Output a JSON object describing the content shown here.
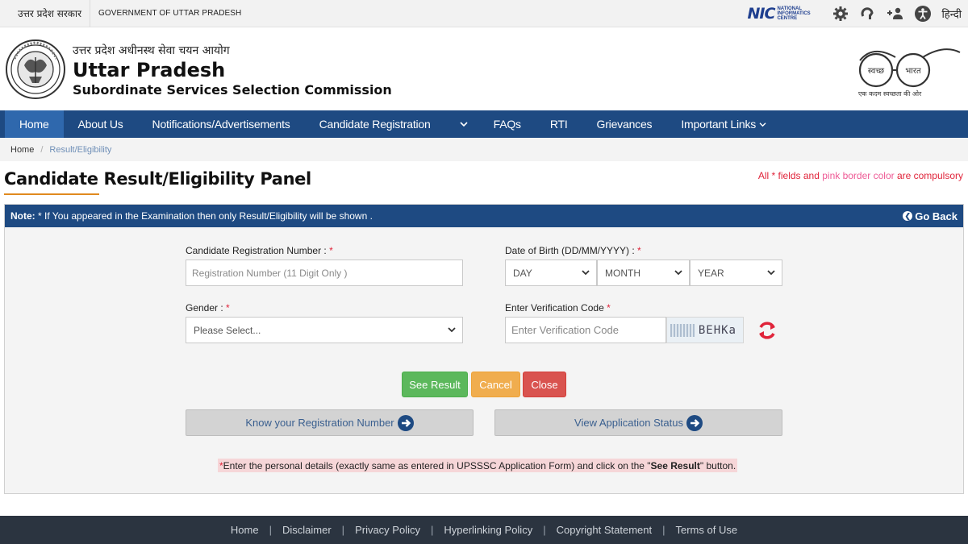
{
  "gov_strip": {
    "state_hindi": "उत्तर प्रदेश सरकार",
    "state_english": "GOVERNMENT OF UTTAR PRADESH",
    "nic_mark": "NIC",
    "nic_text": "NATIONAL INFORMATICS CENTRE",
    "language_toggle": "हिन्दी"
  },
  "header": {
    "title_hindi": "उत्तर प्रदेश अधीनस्थ सेवा चयन आयोग",
    "title_english": "Uttar Pradesh",
    "subtitle": "Subordinate Services Selection Commission",
    "swachh_left": "स्वच्छ",
    "swachh_right": "भारत",
    "swachh_tagline": "एक कदम स्वच्छता की ओर"
  },
  "nav": {
    "items": [
      {
        "label": "Home",
        "active": true
      },
      {
        "label": "About Us"
      },
      {
        "label": "Notifications/Advertisements"
      },
      {
        "label": "Candidate Registration"
      },
      {
        "label": "FAQs"
      },
      {
        "label": "RTI"
      },
      {
        "label": "Grievances"
      },
      {
        "label": "Important Links"
      }
    ]
  },
  "breadcrumb": {
    "home": "Home",
    "current": "Result/Eligibility"
  },
  "page": {
    "title": "Candidate Result/Eligibility Panel",
    "compulsory_prefix": "All * fields and ",
    "compulsory_pink": "pink border color",
    "compulsory_suffix": " are compulsory"
  },
  "panel": {
    "note_label": "Note:",
    "note_text": " * If You appeared in the Examination then only Result/Eligibility will be shown .",
    "go_back": "Go Back"
  },
  "form": {
    "reg_label": "Candidate Registration Number : ",
    "reg_placeholder": "Registration Number (11 Digit Only )",
    "dob_label": "Date of Birth (DD/MM/YYYY) : ",
    "day": "DAY",
    "month": "MONTH",
    "year": "YEAR",
    "gender_label": "Gender : ",
    "gender_value": "Please Select...",
    "captcha_label": "Enter Verification Code ",
    "captcha_placeholder": "Enter Verification Code",
    "captcha_text": "BEHKa",
    "required_mark": "*"
  },
  "buttons": {
    "see_result": "See Result",
    "cancel": "Cancel",
    "close": "Close",
    "know_reg": "Know your Registration Number",
    "view_status": "View Application Status"
  },
  "hint": {
    "star": "* ",
    "text1": "Enter the personal details (exactly same as entered in UPSSSC Application Form) and click on the \"",
    "bold": "See Result",
    "text2": " \" button."
  },
  "footer": {
    "links": [
      "Home",
      "Disclaimer",
      "Privacy Policy",
      "Hyperlinking Policy",
      "Copyright Statement",
      "Terms of Use"
    ]
  },
  "colors": {
    "nav_blue": "#1e4a82",
    "nav_active": "#2f68ad",
    "required_red": "#e0243a",
    "accent_orange": "#e08a1e",
    "green": "#5cb85c",
    "orange": "#f0ad4e",
    "red": "#d9534f"
  }
}
